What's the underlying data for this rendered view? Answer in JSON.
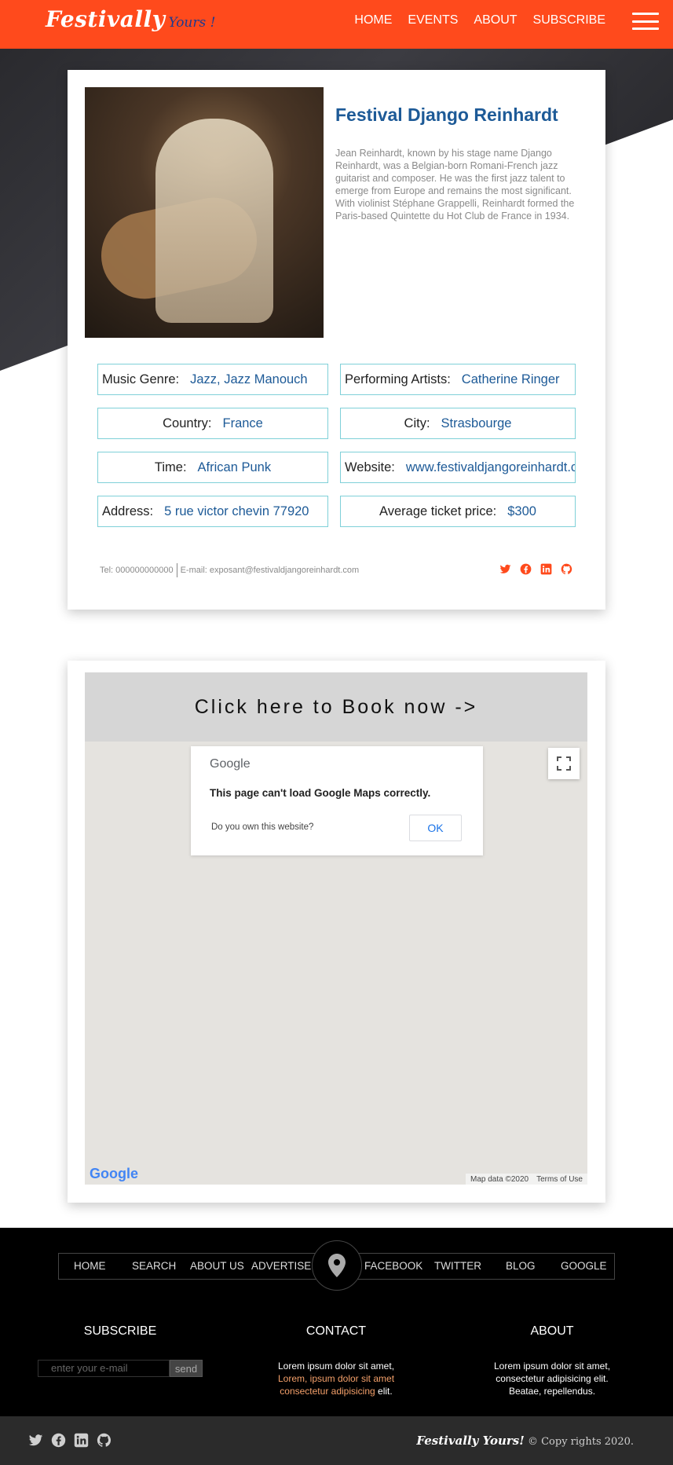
{
  "header": {
    "logo_main": "Festivally",
    "logo_sub": "Yours !",
    "nav": [
      "HOME",
      "EVENTS",
      "ABOUT",
      "SUBSCRIBE"
    ],
    "accent_color": "#ff4a1c"
  },
  "festival": {
    "title": "Festival Django Reinhardt",
    "description": "Jean Reinhardt, known by his stage name Django Reinhardt, was a Belgian-born Romani-French jazz guitarist and composer. He was the first jazz talent to emerge from Europe and remains the most significant. With violinist Stéphane Grappelli, Reinhardt formed the Paris-based Quintette du Hot Club de France in 1934.",
    "fields": {
      "genre_label": "Music Genre:",
      "genre_value": "Jazz, Jazz Manouch",
      "artists_label": "Performing Artists:",
      "artists_value": "Catherine Ringer",
      "country_label": "Country:",
      "country_value": "France",
      "city_label": "City:",
      "city_value": "Strasbourge",
      "time_label": "Time:",
      "time_value": "African Punk",
      "website_label": "Website:",
      "website_value": "www.festivaldjangoreinhardt.com",
      "address_label": "Address:",
      "address_value": "5 rue victor chevin 77920",
      "price_label": "Average ticket price:",
      "price_value": "$300"
    },
    "tel": "Tel: 000000000000",
    "email": "E-mail: exposant@festivaldjangoreinhardt.com",
    "social_icons": [
      "twitter-icon",
      "facebook-icon",
      "linkedin-icon",
      "github-icon"
    ]
  },
  "map": {
    "book_label": "Click here to Book now ->",
    "dialog_brand": "Google",
    "dialog_message": "This page can't load Google Maps correctly.",
    "dialog_question": "Do you own this website?",
    "dialog_ok": "OK",
    "attribution_data": "Map data ©2020",
    "attribution_terms": "Terms of Use",
    "logo": "Google"
  },
  "footer": {
    "nav_left": [
      "HOME",
      "SEARCH",
      "ABOUT US",
      "ADVERTISE"
    ],
    "nav_right": [
      "FACEBOOK",
      "TWITTER",
      "BLOG",
      "GOOGLE"
    ],
    "subscribe_title": "SUBSCRIBE",
    "subscribe_placeholder": "enter your e-mail",
    "subscribe_button": "send",
    "contact_title": "CONTACT",
    "contact_line1": "Lorem ipsum dolor sit amet,",
    "contact_line2": "Lorem, ipsum dolor sit amet",
    "contact_line3a": "consectetur adipisicing",
    "contact_line3b": " elit.",
    "about_title": "ABOUT",
    "about_line1": "Lorem ipsum dolor sit amet,",
    "about_line2": "consectetur adipisicing elit.",
    "about_line3": "Beatae, repellendus.",
    "brand": "Festivally Yours!",
    "copyright": " © Copy rights 2020."
  }
}
